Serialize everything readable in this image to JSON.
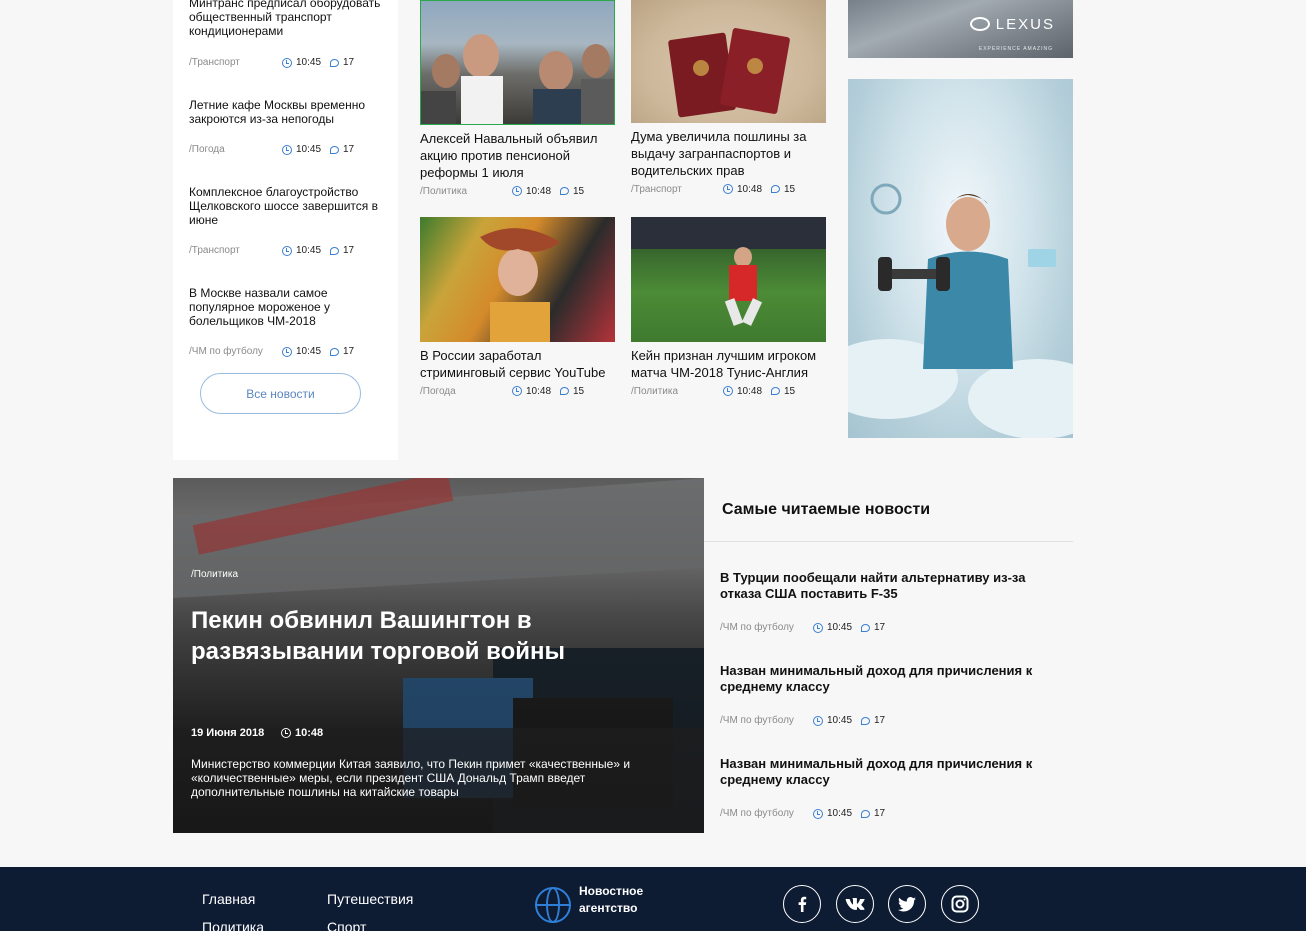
{
  "left_news": [
    {
      "title": "Минтранс предписал оборудовать общественный транспорт кондиционерами",
      "category": "/Транспорт",
      "time": "10:45",
      "comments": "17"
    },
    {
      "title": "Летние кафе Москвы временно закроются из-за непогоды",
      "category": "/Погода",
      "time": "10:45",
      "comments": "17"
    },
    {
      "title": "Комплексное благоустройство Щелковского шоссе завершится в июне",
      "category": "/Транспорт",
      "time": "10:45",
      "comments": "17"
    },
    {
      "title": "В Москве назвали самое популярное мороженое у болельщиков ЧМ-2018",
      "category": "/ЧМ по футболу",
      "time": "10:45",
      "comments": "17"
    }
  ],
  "all_news_button": "Все новости",
  "cards": [
    {
      "title": "Алексей Навальный объявил акцию против пенсионой реформы 1 июля",
      "category": "/Политика",
      "time": "10:48",
      "comments": "15"
    },
    {
      "title": "Дума увеличила пошлины за выдачу загранпаспортов и водительских прав",
      "category": "/Транспорт",
      "time": "10:48",
      "comments": "15"
    },
    {
      "title": "В России заработал стриминговый сервис YouTube",
      "category": "/Погода",
      "time": "10:48",
      "comments": "15"
    },
    {
      "title": "Кейн признан лучшим игроком матча ЧМ-2018 Тунис-Англия",
      "category": "/Политика",
      "time": "10:48",
      "comments": "15"
    }
  ],
  "ad_lexus": {
    "logo": "LEXUS",
    "tagline": "EXPERIENCE AMAZING"
  },
  "featured": {
    "category": "/Политика",
    "title": "Пекин обвинил Вашингтон в развязывании торговой войны",
    "date": "19 Июня 2018",
    "time": "10:48",
    "description": "Министерство коммерции Китая заявило, что Пекин примет «качественные» и «количественные» меры, если президент США Дональд Трамп введет дополнительные пошлины на китайские товары"
  },
  "most_read": {
    "heading": "Самые читаемые новости",
    "items": [
      {
        "title": "В Турции пообещали найти альтернативу из-за отказа США поставить F-35",
        "category": "/ЧМ по футболу",
        "time": "10:45",
        "comments": "17"
      },
      {
        "title": "Назван минимальный доход для причисления к среднему классу",
        "category": "/ЧМ по футболу",
        "time": "10:45",
        "comments": "17"
      },
      {
        "title": "Назван минимальный доход для причисления к среднему классу",
        "category": "/ЧМ по футболу",
        "time": "10:45",
        "comments": "17"
      }
    ]
  },
  "footer": {
    "links_col1": [
      "Главная",
      "Политика"
    ],
    "links_col2": [
      "Путешествия",
      "Спорт"
    ],
    "brand_line1": "Новостное",
    "brand_line2": "агентство",
    "social": [
      "facebook-icon",
      "vk-icon",
      "twitter-icon",
      "instagram-icon"
    ]
  }
}
